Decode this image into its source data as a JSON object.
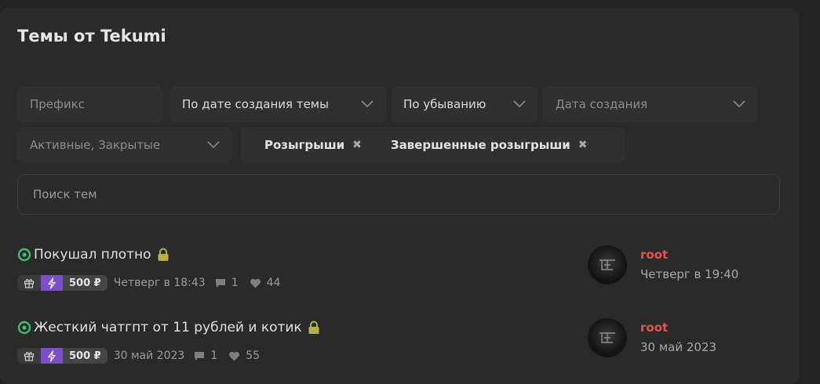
{
  "page": {
    "title": "Темы от Tekumi"
  },
  "filters": {
    "prefix_placeholder": "Префикс",
    "sort_by": "По дате создания темы",
    "order": "По убыванию",
    "date_placeholder": "Дата создания",
    "state": "Активные, Закрытые",
    "tags": [
      "Розыгрыши",
      "Завершенные розыгрыши"
    ]
  },
  "search": {
    "placeholder": "Поиск тем"
  },
  "threads": [
    {
      "title": "Покушал плотно",
      "price": "500 ₽",
      "date": "Четверг в 18:43",
      "replies": "1",
      "likes": "44",
      "last_user": "root",
      "last_date": "Четверг в 19:40"
    },
    {
      "title": "Жесткий чатгпт от 11 рублей и котик",
      "price": "500 ₽",
      "date": "30 май 2023",
      "replies": "1",
      "likes": "55",
      "last_user": "root",
      "last_date": "30 май 2023"
    }
  ],
  "colors": {
    "accent_green": "#3fbf6f",
    "lock_yellow": "#b5b04a",
    "bolt_purple": "#7b4fc7",
    "username_red": "#e2544f"
  }
}
